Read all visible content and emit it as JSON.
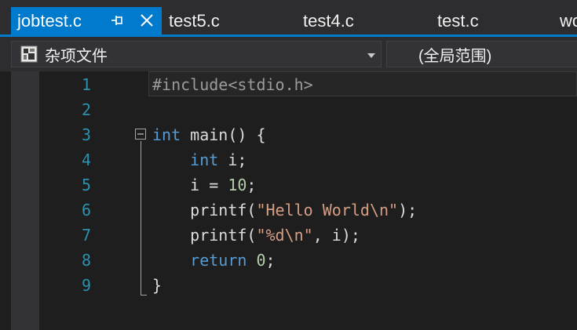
{
  "tabs": [
    {
      "label": "jobtest.c",
      "active": true
    },
    {
      "label": "test5.c"
    },
    {
      "label": "test4.c"
    },
    {
      "label": "test.c"
    },
    {
      "label": "wc"
    }
  ],
  "navbar": {
    "scope_left": "杂项文件",
    "scope_right": "(全局范围)"
  },
  "editor": {
    "line_numbers": [
      "1",
      "2",
      "3",
      "4",
      "5",
      "6",
      "7",
      "8",
      "9"
    ],
    "lines": [
      [
        {
          "t": "#include<stdio.h>",
          "c": "pp"
        }
      ],
      [],
      [
        {
          "t": "int",
          "c": "kw"
        },
        {
          "t": " main() {",
          "c": "txt"
        }
      ],
      [
        {
          "t": "    ",
          "c": "txt"
        },
        {
          "t": "int",
          "c": "kw"
        },
        {
          "t": " i;",
          "c": "txt"
        }
      ],
      [
        {
          "t": "    i = ",
          "c": "txt"
        },
        {
          "t": "10",
          "c": "num"
        },
        {
          "t": ";",
          "c": "txt"
        }
      ],
      [
        {
          "t": "    printf(",
          "c": "txt"
        },
        {
          "t": "\"Hello World\\n\"",
          "c": "str"
        },
        {
          "t": ");",
          "c": "txt"
        }
      ],
      [
        {
          "t": "    printf(",
          "c": "txt"
        },
        {
          "t": "\"%d\\n\"",
          "c": "str"
        },
        {
          "t": ", i);",
          "c": "txt"
        }
      ],
      [
        {
          "t": "    ",
          "c": "txt"
        },
        {
          "t": "return",
          "c": "kw"
        },
        {
          "t": " ",
          "c": "txt"
        },
        {
          "t": "0",
          "c": "num"
        },
        {
          "t": ";",
          "c": "txt"
        }
      ],
      [
        {
          "t": "}",
          "c": "txt"
        }
      ]
    ]
  },
  "colors": {
    "accent": "#007acc",
    "keyword": "#569cd6",
    "string": "#d69d85",
    "number": "#b5cea8",
    "line_number": "#2b91af",
    "preprocessor": "#9b9b9b"
  },
  "icons": {
    "pin": "pin-icon",
    "close": "close-icon",
    "file": "misc-files-icon",
    "dropdown": "chevron-down-icon",
    "fold": "collapse-icon"
  }
}
